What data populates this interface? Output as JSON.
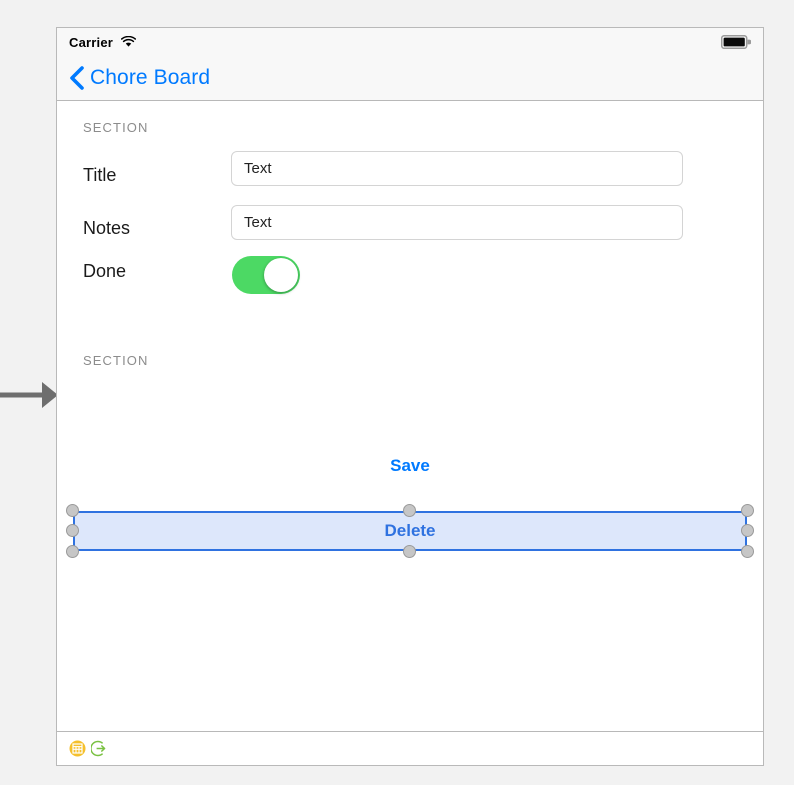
{
  "canvas": {
    "annotation_arrow": "right-arrow-annotation"
  },
  "status_bar": {
    "carrier": "Carrier",
    "wifi_icon": "wifi-icon",
    "battery_icon": "battery-full-icon"
  },
  "nav_bar": {
    "back_icon": "chevron-left-icon",
    "title": "Chore Board"
  },
  "form": {
    "section_1_header": "SECTION",
    "section_2_header": "SECTION",
    "rows": [
      {
        "label": "Title",
        "value": "Text"
      },
      {
        "label": "Notes",
        "value": "Text"
      }
    ],
    "toggle_row": {
      "label": "Done",
      "state": "on",
      "on_color": "#4cd964"
    }
  },
  "actions": {
    "save_label": "Save",
    "delete_label": "Delete",
    "delete_selected": true,
    "selection_color": "#2f72e0",
    "selection_fill": "#dde7fb"
  },
  "dock": {
    "icons": [
      {
        "name": "view-controller-icon",
        "color": "#f5c02c"
      },
      {
        "name": "exit-segue-icon",
        "color": "#7ac143"
      }
    ]
  }
}
